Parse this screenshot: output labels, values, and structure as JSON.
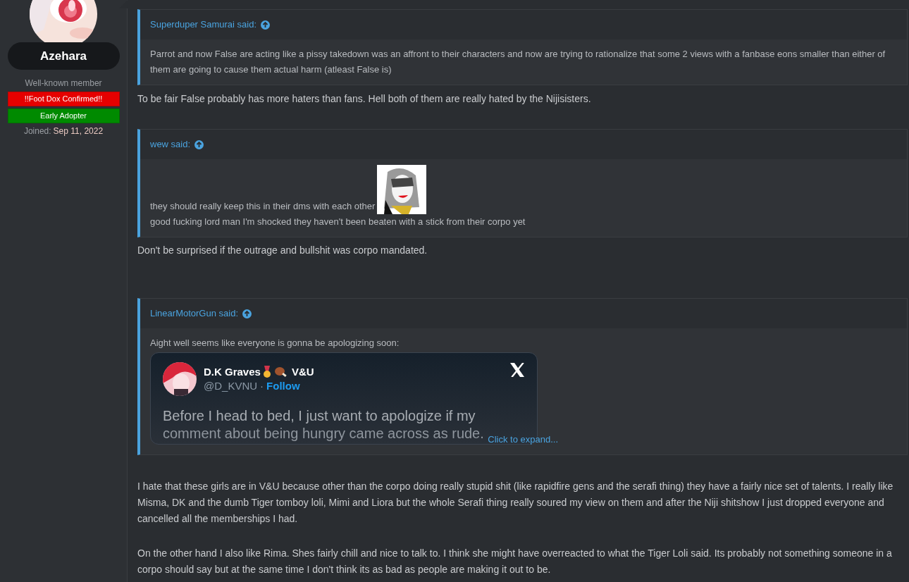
{
  "user": {
    "name": "Azehara",
    "title": "Well-known member",
    "banners": [
      {
        "label": "!!Foot Dox Confirmed!!",
        "color": "#e60000"
      },
      {
        "label": "Early Adopter",
        "color": "#008a00"
      }
    ],
    "joined_label": "Joined:",
    "joined_date": "Sep 11, 2022"
  },
  "content": [
    {
      "kind": "quote",
      "author": "Superduper Samurai said:",
      "lines": [
        {
          "text": "Parrot and now False are acting like a pissy takedown was an affront to their characters and now are trying to rationalize that some 2 views with a fanbase eons smaller than either of them are going to cause them actual harm (atleast False is)"
        }
      ]
    },
    {
      "kind": "text",
      "text": "To be fair False probably has more haters than fans. Hell both of them are really hated by the Nijisisters."
    },
    {
      "kind": "quote",
      "author": "wew said:",
      "lines": [
        {
          "text": "they should really keep this in their dms with each other",
          "inline_picture": true
        },
        {
          "text": "good fucking lord man I'm shocked they haven't been beaten with a stick from their corpo yet"
        }
      ]
    },
    {
      "kind": "text",
      "text": "Don't be surprised if the outrage and bullshit was corpo mandated."
    },
    {
      "kind": "quote",
      "author": "LinearMotorGun said:",
      "lines": [
        {
          "text": "Aight well seems like everyone is gonna be apologizing soon:"
        }
      ],
      "tweet": {
        "name": "D.K Graves",
        "suffix": "V&U",
        "handle": "@D_KVNU",
        "separator": "·",
        "follow": "Follow",
        "lines": [
          "Before I head to bed, I just want to apologize if my",
          "comment about being hungry came across as rude."
        ]
      },
      "expand": "Click to expand..."
    },
    {
      "kind": "text",
      "text": "I hate that these girls are in V&U because other than the corpo doing really stupid shit (like rapidfire gens and the serafi thing) they have a fairly nice set of talents. I really like Misma, DK and the dumb Tiger tomboy loli, Mimi and Liora but the whole Serafi thing really soured my view on them and after the Niji shitshow I just dropped everyone and cancelled all the memberships I had."
    },
    {
      "kind": "text",
      "text": "On the other hand I also like Rima. Shes fairly chill and nice to talk to. I think she might have overreacted to what the Tiger Loli said. Its probably not something someone in a corpo should say but at the same time I don't think its as bad as people are making it out to be."
    }
  ]
}
